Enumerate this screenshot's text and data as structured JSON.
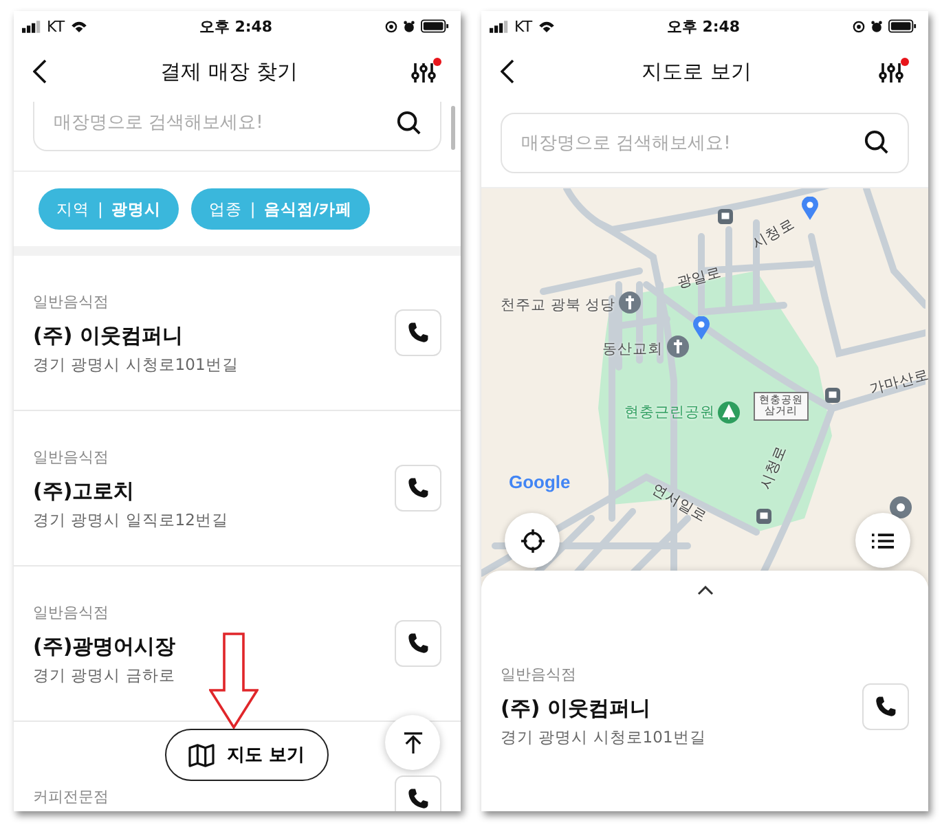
{
  "list_screen": {
    "status_bar": {
      "carrier": "KT",
      "time": "오후 2:48"
    },
    "title": "결제 매장 찾기",
    "search": {
      "placeholder": "매장명으로 검색해보세요!"
    },
    "filters": [
      {
        "label": "지역",
        "separator": "|",
        "value": "광명시"
      },
      {
        "label": "업종",
        "separator": "|",
        "value": "음식점/카페"
      }
    ],
    "stores": [
      {
        "category": "일반음식점",
        "name": "(주) 이웃컴퍼니",
        "address": "경기 광명시 시청로101번길"
      },
      {
        "category": "일반음식점",
        "name": "(주)고로치",
        "address": "경기 광명시 일직로12번길"
      },
      {
        "category": "일반음식점",
        "name": "(주)광명어시장",
        "address": "경기 광명시 금하로"
      },
      {
        "category": "커피전문점"
      }
    ],
    "map_button": "지도 보기"
  },
  "map_screen": {
    "status_bar": {
      "carrier": "KT",
      "time": "오후 2:48"
    },
    "title": "지도로 보기",
    "search": {
      "placeholder": "매장명으로 검색해보세요!"
    },
    "map": {
      "labels": [
        "시청로",
        "광일로",
        "천주교 광북 성당",
        "동산교회",
        "현충근린공원",
        "가마산로",
        "시청로",
        "연서일로"
      ],
      "junction": [
        "현충공원",
        "삼거리"
      ],
      "attribution": "Google"
    },
    "store": {
      "category": "일반음식점",
      "name": "(주) 이웃컴퍼니",
      "address": "경기 광명시 시청로101번길"
    }
  }
}
